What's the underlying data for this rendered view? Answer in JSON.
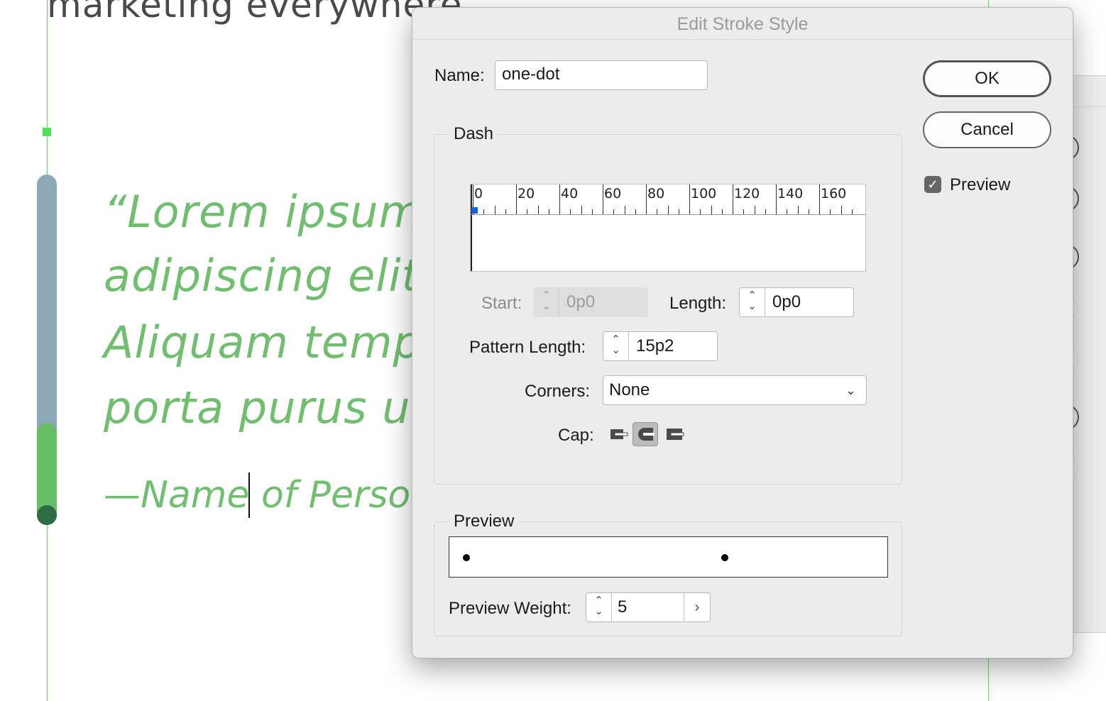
{
  "canvas": {
    "headline": "marketing everywhere",
    "quote_lines": [
      "“Lorem ipsum d",
      "adipiscing elit. I",
      "Aliquam tempu",
      "porta purus ulla"
    ],
    "attribution_before_cursor": "—Name ",
    "attribution_after_cursor": "of Person"
  },
  "dialog": {
    "title": "Edit Stroke Style",
    "name_label": "Name:",
    "name_value": "one-dot",
    "ok_label": "OK",
    "cancel_label": "Cancel",
    "preview_checkbox_label": "Preview",
    "preview_checked": true,
    "dash": {
      "group_title": "Dash",
      "ruler_ticks": [
        "0",
        "20",
        "40",
        "60",
        "80",
        "100",
        "120",
        "140",
        "160"
      ],
      "start_label": "Start:",
      "start_value": "0p0",
      "length_label": "Length:",
      "length_value": "0p0",
      "pattern_length_label": "Pattern Length:",
      "pattern_length_value": "15p2",
      "corners_label": "Corners:",
      "corners_value": "None",
      "cap_label": "Cap:",
      "cap_options": [
        "butt-cap-icon",
        "round-cap-icon",
        "projecting-cap-icon"
      ],
      "cap_selected": "round-cap-icon"
    },
    "preview": {
      "group_title": "Preview",
      "weight_label": "Preview Weight:",
      "weight_value": "5"
    }
  },
  "colors": {
    "guide_green": "#5fe05f",
    "quote_green": "#72bd72",
    "slider_track": "#8ea8b8",
    "slider_fill": "#66bf66",
    "slider_knob": "#2e6b44",
    "ruler_marker_blue": "#1b5fd9"
  }
}
